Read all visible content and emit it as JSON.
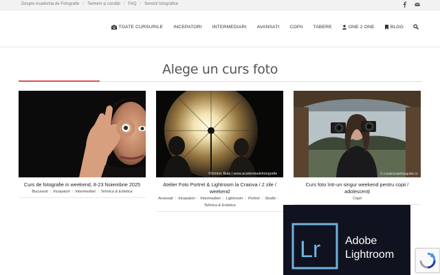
{
  "topbar": {
    "links": [
      "Despre Academia de Fotografie",
      "Termeni și condiții",
      "FAQ",
      "Servicii fotografice"
    ],
    "icons": [
      "facebook-icon",
      "envelope-icon"
    ]
  },
  "nav": {
    "items": [
      {
        "label": "TOATE CURSURILE",
        "icon": "camera-icon"
      },
      {
        "label": "INCEPATORI"
      },
      {
        "label": "INTERMEDIARI"
      },
      {
        "label": "AVANSATI"
      },
      {
        "label": "COPII"
      },
      {
        "label": "TABERE"
      },
      {
        "label": "ONE 2 ONE",
        "icon": "user-icon"
      },
      {
        "label": "BLOG",
        "icon": "bookmark-icon"
      }
    ],
    "search_icon": "search-icon"
  },
  "main": {
    "heading": "Alege un curs foto",
    "accent_color": "#d9534f",
    "cards": [
      {
        "title": "Curs de fotografie in weekend, 8-23 Noiembrie 2025",
        "tags": [
          "Bucuresti",
          "Incepatori",
          "Intermediari",
          "Tehnica & Estetica"
        ]
      },
      {
        "title": "Atelier Foto Portret & Lightroom la Craiova / 2 zile / weekend",
        "tags": [
          "Avansati",
          "Incepatori",
          "Intermediari",
          "Lightroom",
          "Portret",
          "Studio",
          "Tehnica & Estetica"
        ],
        "watermark": "©Simion Buia | www.academiadefotografie"
      },
      {
        "title": "Curs foto într-un singur weekend pentru copii / adolescenți",
        "tags": [
          "Copii"
        ],
        "watermark": "© Academiadefotografie.ro"
      }
    ],
    "banner": {
      "logo": "Lr",
      "line1": "Adobe",
      "line2": "Lightroom"
    }
  }
}
